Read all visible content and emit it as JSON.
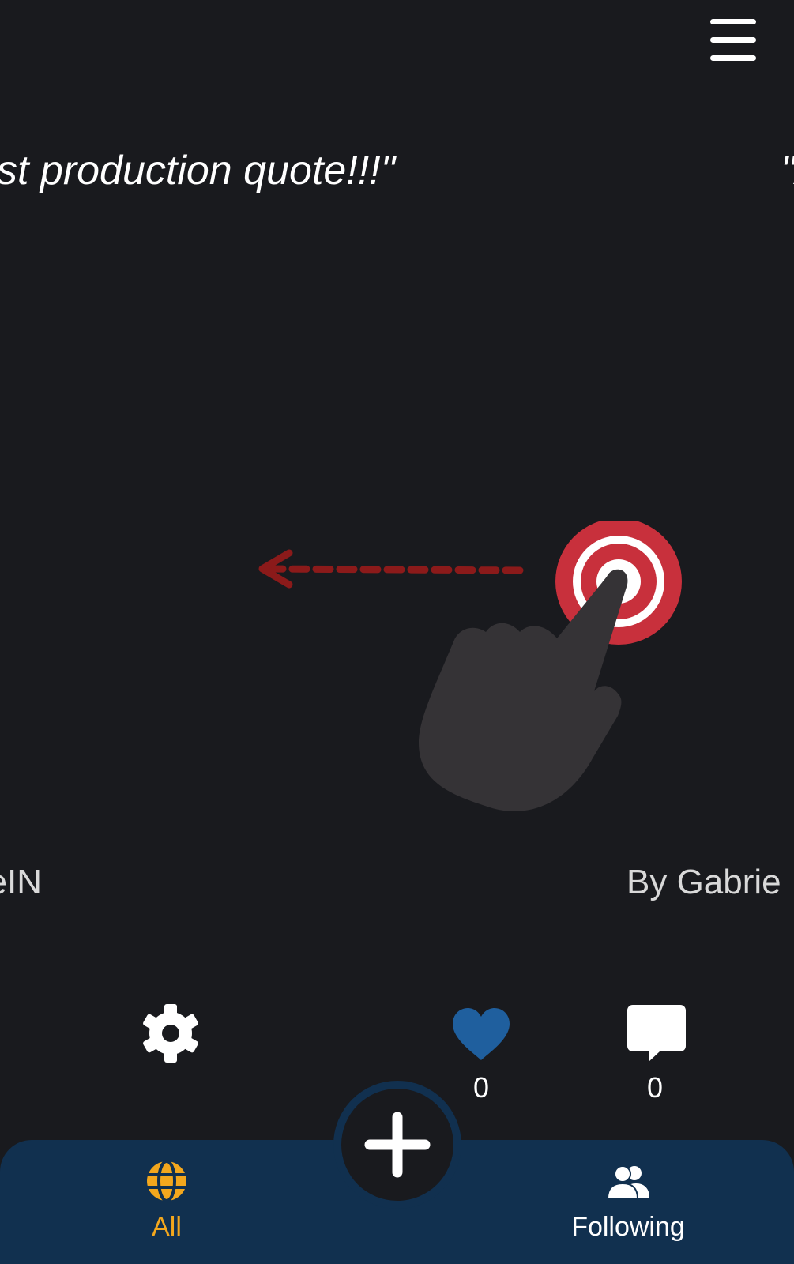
{
  "header": {
    "menu_icon": "hamburger-menu-icon"
  },
  "quotes": {
    "current_text": "st production quote!!!\"",
    "next_text": "\"A"
  },
  "authors": {
    "current_text": "eIN",
    "next_text": "By Gabrie"
  },
  "tutorial_overlay": {
    "hand_icon": "pointing-hand-icon",
    "target_icon": "tap-target-icon",
    "arrow_icon": "swipe-left-arrow-icon",
    "target_color": "#c8303c",
    "arrow_color": "#8b1a1a"
  },
  "actions": {
    "settings_icon": "gear-icon",
    "like_icon": "heart-icon",
    "like_color": "#1f5f9e",
    "like_count": "0",
    "comment_icon": "comment-icon",
    "comment_count": "0"
  },
  "bottom_nav": {
    "background": "#11304f",
    "active_color": "#f3a71d",
    "tabs": [
      {
        "label": "All",
        "icon": "globe-icon",
        "active": true
      },
      {
        "label": "Following",
        "icon": "people-icon",
        "active": false
      }
    ],
    "fab_icon": "plus-icon"
  }
}
